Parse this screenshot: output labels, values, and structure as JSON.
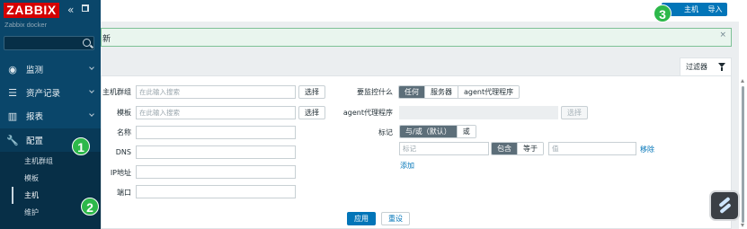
{
  "sidebar": {
    "logo": "ZABBIX",
    "server_name": "Zabbix docker",
    "collapse_icon": "double-chevron-left-icon",
    "kiosk_icon": "expand-icon",
    "menu": [
      {
        "label": "监测",
        "icon": "eye-icon"
      },
      {
        "label": "资产记录",
        "icon": "list-icon"
      },
      {
        "label": "报表",
        "icon": "bar-chart-icon"
      },
      {
        "label": "配置",
        "icon": "wrench-icon"
      }
    ],
    "submenu": [
      "主机群组",
      "模板",
      "主机",
      "维护"
    ]
  },
  "header": {
    "create_host_label": "主机",
    "import_label": "导入"
  },
  "message": {
    "text": "新",
    "close_glyph": "×"
  },
  "filter": {
    "tab_label": "过滤器",
    "host_groups_label": "主机群组",
    "host_groups_placeholder": "在此输入搜索",
    "templates_label": "模板",
    "templates_placeholder": "在此输入搜索",
    "select_label": "选择",
    "name_label": "名称",
    "dns_label": "DNS",
    "ip_label": "IP地址",
    "port_label": "端口",
    "monitored_by_label": "要监控什么",
    "monitored_by_options": [
      "任何",
      "服务器",
      "agent代理程序"
    ],
    "monitored_by_selected": 0,
    "proxy_label": "agent代理程序",
    "tags_label": "标记",
    "tags_mode_options": [
      "与/或（默认）",
      "或"
    ],
    "tags_mode_selected": 0,
    "tag_placeholder": "标记",
    "tag_operator_options": [
      "包含",
      "等于"
    ],
    "tag_operator_selected": 0,
    "value_placeholder": "值",
    "remove_label": "移除",
    "add_label": "添加",
    "apply_label": "应用",
    "reset_label": "重设"
  },
  "annotations": {
    "markers": [
      "1",
      "2",
      "3"
    ],
    "marker_color": "#2db84a"
  },
  "colors": {
    "sidebar_bg": "#0a466a",
    "brand_red": "#d40000",
    "primary_blue": "#0275b8"
  }
}
